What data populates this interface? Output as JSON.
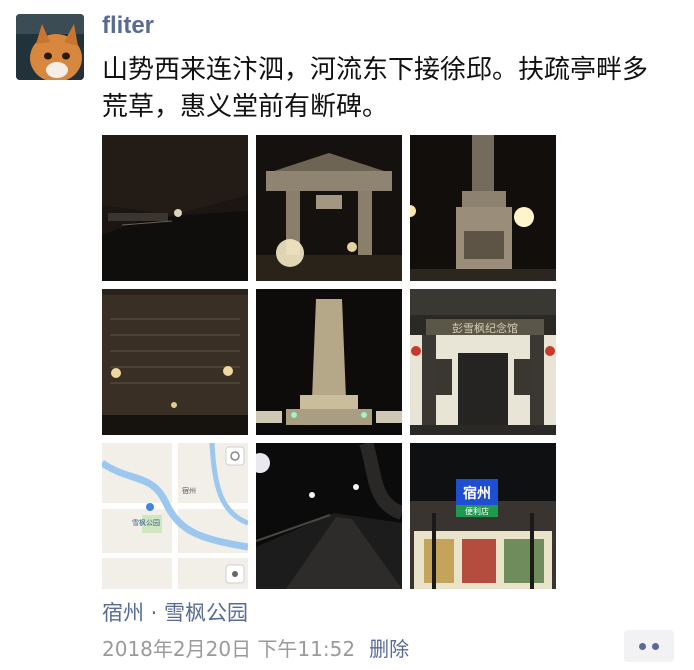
{
  "post": {
    "author": "fliter",
    "text": "山势西来连汴泗，河流东下接徐邱。扶疏亭畔多荒草，惠义堂前有断碑。",
    "photo_count": 9,
    "location": "宿州 · 雪枫公园",
    "timestamp": "2018年2月20日 下午11:52",
    "delete_label": "删除"
  },
  "photos": [
    {
      "subject": "night riverside"
    },
    {
      "subject": "memorial gate archway"
    },
    {
      "subject": "statue at night"
    },
    {
      "subject": "engraved stone tablet"
    },
    {
      "subject": "memorial obelisk"
    },
    {
      "subject": "memorial hall entrance",
      "sign": "彭雪枫纪念馆"
    },
    {
      "subject": "map screenshot",
      "labels": [
        "宿州",
        "雪枫公园"
      ]
    },
    {
      "subject": "empty road at night"
    },
    {
      "subject": "convenience store",
      "sign_top": "宿州",
      "sign_bottom": "便利店"
    }
  ],
  "icons": {
    "avatar": "orange-cat-avatar",
    "more": "more-dots-icon"
  }
}
